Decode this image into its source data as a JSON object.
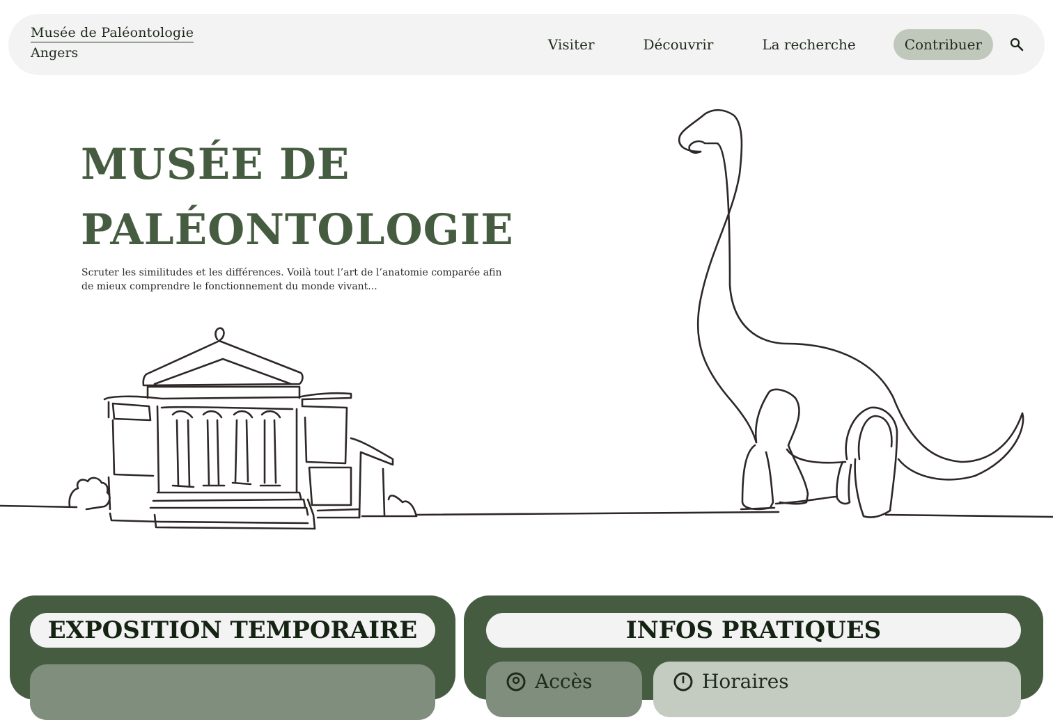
{
  "header": {
    "brand_line1": "Musée de Paléontologie",
    "brand_line2": "Angers",
    "nav": [
      {
        "label": "Visiter",
        "active": false
      },
      {
        "label": "Découvrir",
        "active": false
      },
      {
        "label": "La recherche",
        "active": false
      },
      {
        "label": "Contribuer",
        "active": true
      }
    ],
    "search_icon": "search-icon"
  },
  "hero": {
    "title_line1": "MUSÉE DE",
    "title_line2": "PALÉONTOLOGIE",
    "subtitle": "Scruter les similitudes et les différences. Voilà tout l’art de l’anatomie comparée afin de mieux comprendre le fonctionnement du monde vivant..."
  },
  "sections": {
    "expo_title": "EXPOSITION TEMPORAIRE",
    "infos_title": "INFOS PRATIQUES",
    "infos_cards": [
      {
        "label": "Accès",
        "icon": "location-icon"
      },
      {
        "label": "Horaires",
        "icon": "clock-icon"
      }
    ]
  },
  "colors": {
    "accent_green": "#465c41",
    "nav_active_bg": "#bfc8bb",
    "bar_bg": "#f3f3f3",
    "card_mid": "#808f7d",
    "card_light": "#c4ccc1",
    "line_art": "#2e2727"
  }
}
